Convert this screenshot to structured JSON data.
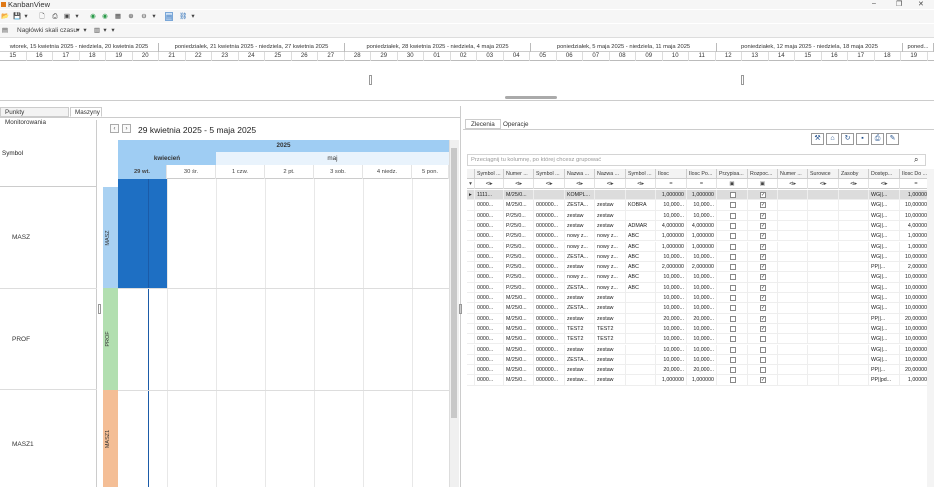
{
  "app": {
    "title": "KanbanView"
  },
  "window_controls": {
    "minimize": "–",
    "restore": "❐",
    "close": "✕"
  },
  "toolbar": {
    "scale_headers_label": "Nagłówki skali czasu"
  },
  "timeline": {
    "weeks": [
      "wtorek, 15 kwietnia 2025 - niedziela, 20 kwietnia 2025",
      "poniedziałek, 21 kwietnia 2025 - niedziela, 27 kwietnia 2025",
      "poniedziałek, 28 kwietnia 2025 - niedziela, 4 maja 2025",
      "poniedziałek, 5 maja 2025 - niedziela, 11 maja 2025",
      "poniedziałek, 12 maja 2025 - niedziela, 18 maja 2025",
      "poned..."
    ],
    "days": [
      "15",
      "16",
      "17",
      "18",
      "19",
      "20",
      "21",
      "22",
      "23",
      "24",
      "25",
      "26",
      "27",
      "28",
      "29",
      "30",
      "01",
      "02",
      "03",
      "04",
      "05",
      "06",
      "07",
      "08",
      "09",
      "10",
      "11",
      "12",
      "13",
      "14",
      "15",
      "16",
      "17",
      "18",
      "19"
    ]
  },
  "left": {
    "tabs": [
      "Punkty Monitorowania",
      "Maszyny"
    ],
    "symbol_header": "Symbol",
    "rows": [
      "MASZ",
      "PROF",
      "MASZ1"
    ],
    "date_range": "29 kwietnia 2025 - 5 maja 2025",
    "year": "2025",
    "months": [
      "kwiecień",
      "maj"
    ],
    "days": [
      "29 wt.",
      "30 śr.",
      "1 czw.",
      "2 pt.",
      "3 sob.",
      "4 niedz.",
      "5 pon."
    ]
  },
  "right": {
    "tabs": [
      "Zlecenia",
      "Operacje"
    ],
    "search_placeholder": "Przeciągnij tu kolumnę, po której chcesz grupować",
    "columns": [
      "Symbol ...",
      "Numer ...",
      "Symbol ...",
      "Nazwa ...",
      "Nazwa ...",
      "Symbol ...",
      "Ilosc",
      "Ilosc Po...",
      "Przypisa...",
      "Rozpoc...",
      "Numer ...",
      "Surowce",
      "Zasoby",
      "Dostęp...",
      "Ilosc Do ..."
    ],
    "rows": [
      [
        "1111...",
        "M/25/0...",
        "",
        "KOMPL...",
        "",
        "",
        "1,000000",
        "1,000000",
        false,
        true,
        "",
        "",
        "",
        "WG||...",
        "1,000000"
      ],
      [
        "0000...",
        "M/25/0...",
        "000000...",
        "ZESTA...",
        "zestaw",
        "KOBRA",
        "10,000...",
        "10,000...",
        false,
        true,
        "",
        "",
        "",
        "WG||...",
        "10,000000"
      ],
      [
        "0000...",
        "P/25/0...",
        "000000...",
        "zestaw",
        "zestaw",
        "",
        "10,000...",
        "10,000...",
        false,
        true,
        "",
        "",
        "",
        "WG||...",
        "10,000000"
      ],
      [
        "0000...",
        "P/25/0...",
        "000000...",
        "zestaw",
        "zestaw",
        "ADMAR",
        "4,000000",
        "4,000000",
        false,
        true,
        "",
        "",
        "",
        "WG||...",
        "4,000000"
      ],
      [
        "0000...",
        "P/25/0...",
        "000000...",
        "nowy z...",
        "nowy z...",
        "ABC",
        "1,000000",
        "1,000000",
        false,
        true,
        "",
        "",
        "",
        "WG||...",
        "1,000000"
      ],
      [
        "0000...",
        "P/25/0...",
        "000000...",
        "nowy z...",
        "nowy z...",
        "ABC",
        "1,000000",
        "1,000000",
        false,
        true,
        "",
        "",
        "",
        "WG||...",
        "1,000000"
      ],
      [
        "0000...",
        "P/25/0...",
        "000000...",
        "ZESTA...",
        "nowy z...",
        "ABC",
        "10,000...",
        "10,000...",
        false,
        true,
        "",
        "",
        "",
        "WG||...",
        "10,000000"
      ],
      [
        "0000...",
        "P/25/0...",
        "000000...",
        "zestaw",
        "nowy z...",
        "ABC",
        "2,000000",
        "2,000000",
        false,
        true,
        "",
        "",
        "",
        "PP||...",
        "2,000000"
      ],
      [
        "0000...",
        "P/25/0...",
        "000000...",
        "nowy z...",
        "nowy z...",
        "ABC",
        "10,000...",
        "10,000...",
        false,
        true,
        "",
        "",
        "",
        "WG||...",
        "10,000000"
      ],
      [
        "0000...",
        "P/25/0...",
        "000000...",
        "ZESTA...",
        "nowy z...",
        "ABC",
        "10,000...",
        "10,000...",
        false,
        true,
        "",
        "",
        "",
        "WG||...",
        "10,000000"
      ],
      [
        "0000...",
        "M/25/0...",
        "000000...",
        "zestaw",
        "zestaw",
        "",
        "10,000...",
        "10,000...",
        false,
        true,
        "",
        "",
        "",
        "WG||...",
        "10,000000"
      ],
      [
        "0000...",
        "M/25/0...",
        "000000...",
        "ZESTA...",
        "zestaw",
        "",
        "10,000...",
        "10,000...",
        false,
        true,
        "",
        "",
        "",
        "WG||...",
        "10,000000"
      ],
      [
        "0000...",
        "M/25/0...",
        "000000...",
        "zestaw",
        "zestaw",
        "",
        "20,000...",
        "20,000...",
        false,
        true,
        "",
        "",
        "",
        "PP||...",
        "20,000000"
      ],
      [
        "0000...",
        "M/25/0...",
        "000000...",
        "TEST2",
        "TEST2",
        "",
        "10,000...",
        "10,000...",
        false,
        true,
        "",
        "",
        "",
        "WG||...",
        "10,000000"
      ],
      [
        "0000...",
        "M/25/0...",
        "000000...",
        "TEST2",
        "TEST2",
        "",
        "10,000...",
        "10,000...",
        false,
        false,
        "",
        "",
        "",
        "WG||...",
        "10,000000"
      ],
      [
        "0000...",
        "M/25/0...",
        "000000...",
        "zestaw",
        "zestaw",
        "",
        "10,000...",
        "10,000...",
        false,
        false,
        "",
        "",
        "",
        "WG||...",
        "10,000000"
      ],
      [
        "0000...",
        "M/25/0...",
        "000000...",
        "ZESTA...",
        "zestaw",
        "",
        "10,000...",
        "10,000...",
        false,
        false,
        "",
        "",
        "",
        "WG||...",
        "10,000000"
      ],
      [
        "0000...",
        "M/25/0...",
        "000000...",
        "zestaw",
        "zestaw",
        "",
        "20,000...",
        "20,000...",
        false,
        false,
        "",
        "",
        "",
        "PP||...",
        "20,000000"
      ],
      [
        "0000...",
        "M/25/0...",
        "000000...",
        "zestaw...",
        "zestaw",
        "",
        "1,000000",
        "1,000000",
        false,
        true,
        "",
        "",
        "",
        "PP||pd...",
        "1,000000"
      ]
    ]
  }
}
